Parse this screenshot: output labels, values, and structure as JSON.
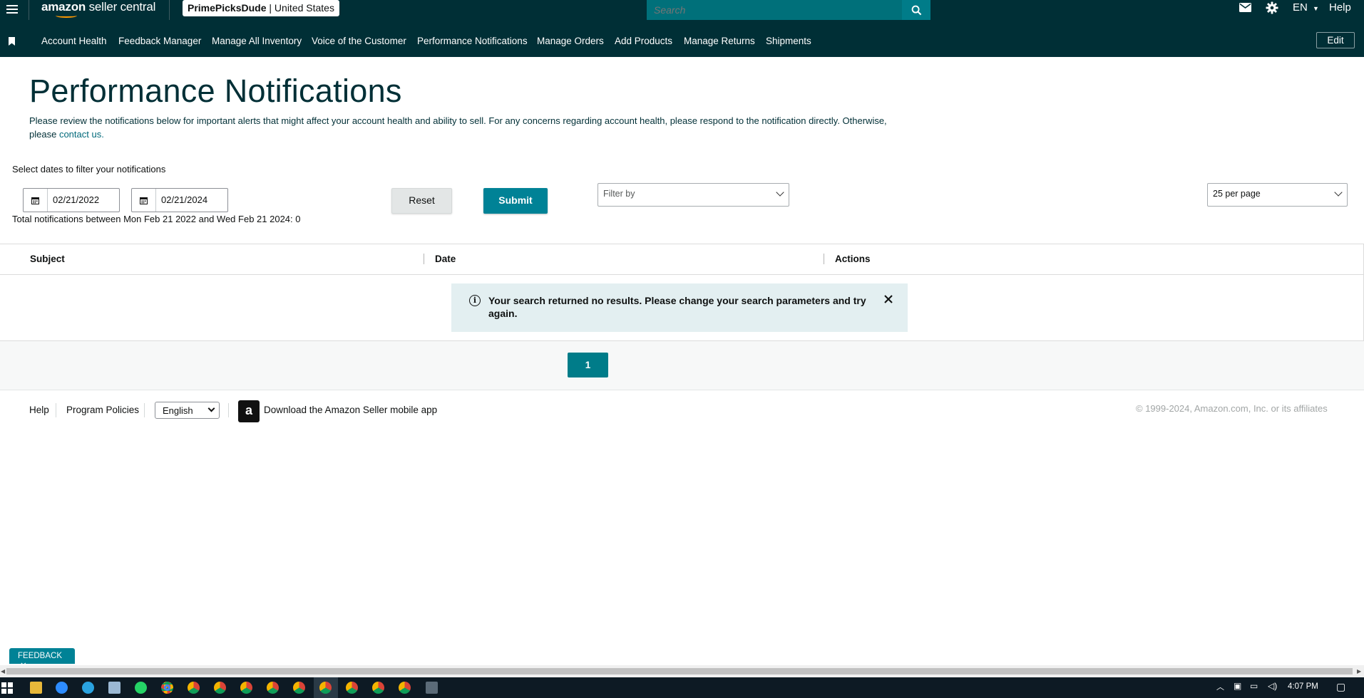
{
  "header": {
    "logo_brand": "amazon",
    "logo_product": "seller central",
    "account_name": "PrimePicksDude",
    "account_separator": "|",
    "marketplace": "United States",
    "search_placeholder": "Search",
    "language": "EN",
    "help": "Help",
    "icons": [
      "menu-icon",
      "search-icon",
      "mail-icon",
      "gear-icon",
      "chevron-down-icon"
    ]
  },
  "nav": {
    "items": [
      "Account Health",
      "Feedback Manager",
      "Manage All Inventory",
      "Voice of the Customer",
      "Performance Notifications",
      "Manage Orders",
      "Add Products",
      "Manage Returns",
      "Shipments"
    ],
    "edit": "Edit"
  },
  "page": {
    "title": "Performance Notifications",
    "intro": "Please review the notifications below for important alerts that might affect your account health and ability to sell. For any concerns regarding account health, please respond to the notification directly. Otherwise, please",
    "intro_link": "contact us.",
    "filter_label": "Select dates to filter your notifications",
    "start_date": "02/21/2022",
    "end_date": "02/21/2024",
    "reset": "Reset",
    "submit": "Submit",
    "filter_by_placeholder": "Filter by",
    "per_page": "25 per page",
    "total_line": "Total notifications between Mon Feb 21 2022 and Wed Feb 21 2024: 0"
  },
  "table": {
    "columns": [
      "Subject",
      "Date",
      "Actions"
    ],
    "empty_message": "Your search returned no results. Please change your search parameters and try again."
  },
  "pagination": {
    "current_page": "1"
  },
  "footer": {
    "help": "Help",
    "program_policies": "Program Policies",
    "language_value": "English",
    "app_download": "Download the Amazon Seller mobile app",
    "copyright": "© 1999-2024, Amazon.com, Inc. or its affiliates"
  },
  "feedback_tab": "FEEDBACK",
  "taskbar": {
    "time": "4:07 PM"
  },
  "colors": {
    "header_bg": "#002f36",
    "accent": "#008296",
    "alert_bg": "#e3eff1",
    "brand_orange": "#ff9900"
  }
}
